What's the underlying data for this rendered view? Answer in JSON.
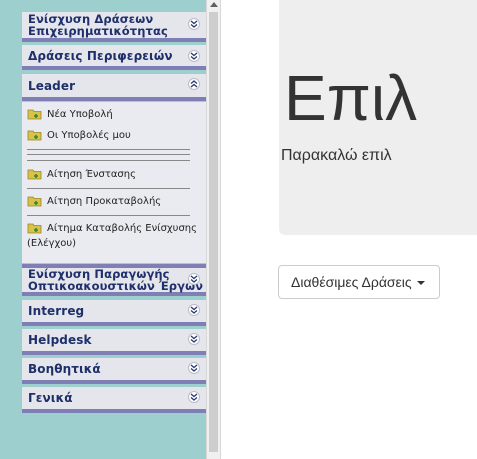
{
  "sidebar": {
    "menus": [
      {
        "label": "Ενίσχυση Δράσεων Επιχειρηματικότητας",
        "state": "collapsed"
      },
      {
        "label": "Δράσεις Περιφερειών",
        "state": "collapsed"
      },
      {
        "label": "Leader",
        "state": "expanded"
      },
      {
        "label": "Ενίσχυση Παραγωγής Οπτικοακουστικών Έργων",
        "state": "collapsed"
      },
      {
        "label": "Interreg",
        "state": "collapsed"
      },
      {
        "label": "Helpdesk",
        "state": "collapsed"
      },
      {
        "label": "Βοηθητικά",
        "state": "collapsed"
      },
      {
        "label": "Γενικά",
        "state": "collapsed"
      }
    ],
    "menu_lines": [
      [
        "Ενίσχυση Δράσεων",
        "Επιχειρηματικότητας"
      ],
      [
        "Ενίσχυση Παραγωγής",
        "Οπτικοακουστικών Έργων"
      ]
    ],
    "leader_items": [
      {
        "label": "Νέα Υποβολή"
      },
      {
        "label": "Οι Υποβολές μου"
      },
      {
        "label": "Αίτηση Ένστασης"
      },
      {
        "label": "Αίτηση Προκαταβολής"
      },
      {
        "label": "Αίτημα Καταβολής Ενίσχυσης (Ελέγχου)"
      }
    ]
  },
  "main": {
    "title": "Επιλ",
    "lead": "Παρακαλώ επιλ",
    "dropdown_label": "Διαθέσιμες Δράσεις"
  },
  "colors": {
    "sidebar_bg": "#9ecfcf",
    "menu_header_bg": "#e4e6ec",
    "menu_header_border": "#7f7fb5",
    "menu_text": "#1f2f6b",
    "folder_icon": "#d9c24a",
    "jumbotron_bg": "#eeeeee"
  },
  "icons": {
    "collapsed": "double-chevron-down-icon",
    "expanded": "double-chevron-up-icon",
    "item": "folder-add-icon"
  }
}
